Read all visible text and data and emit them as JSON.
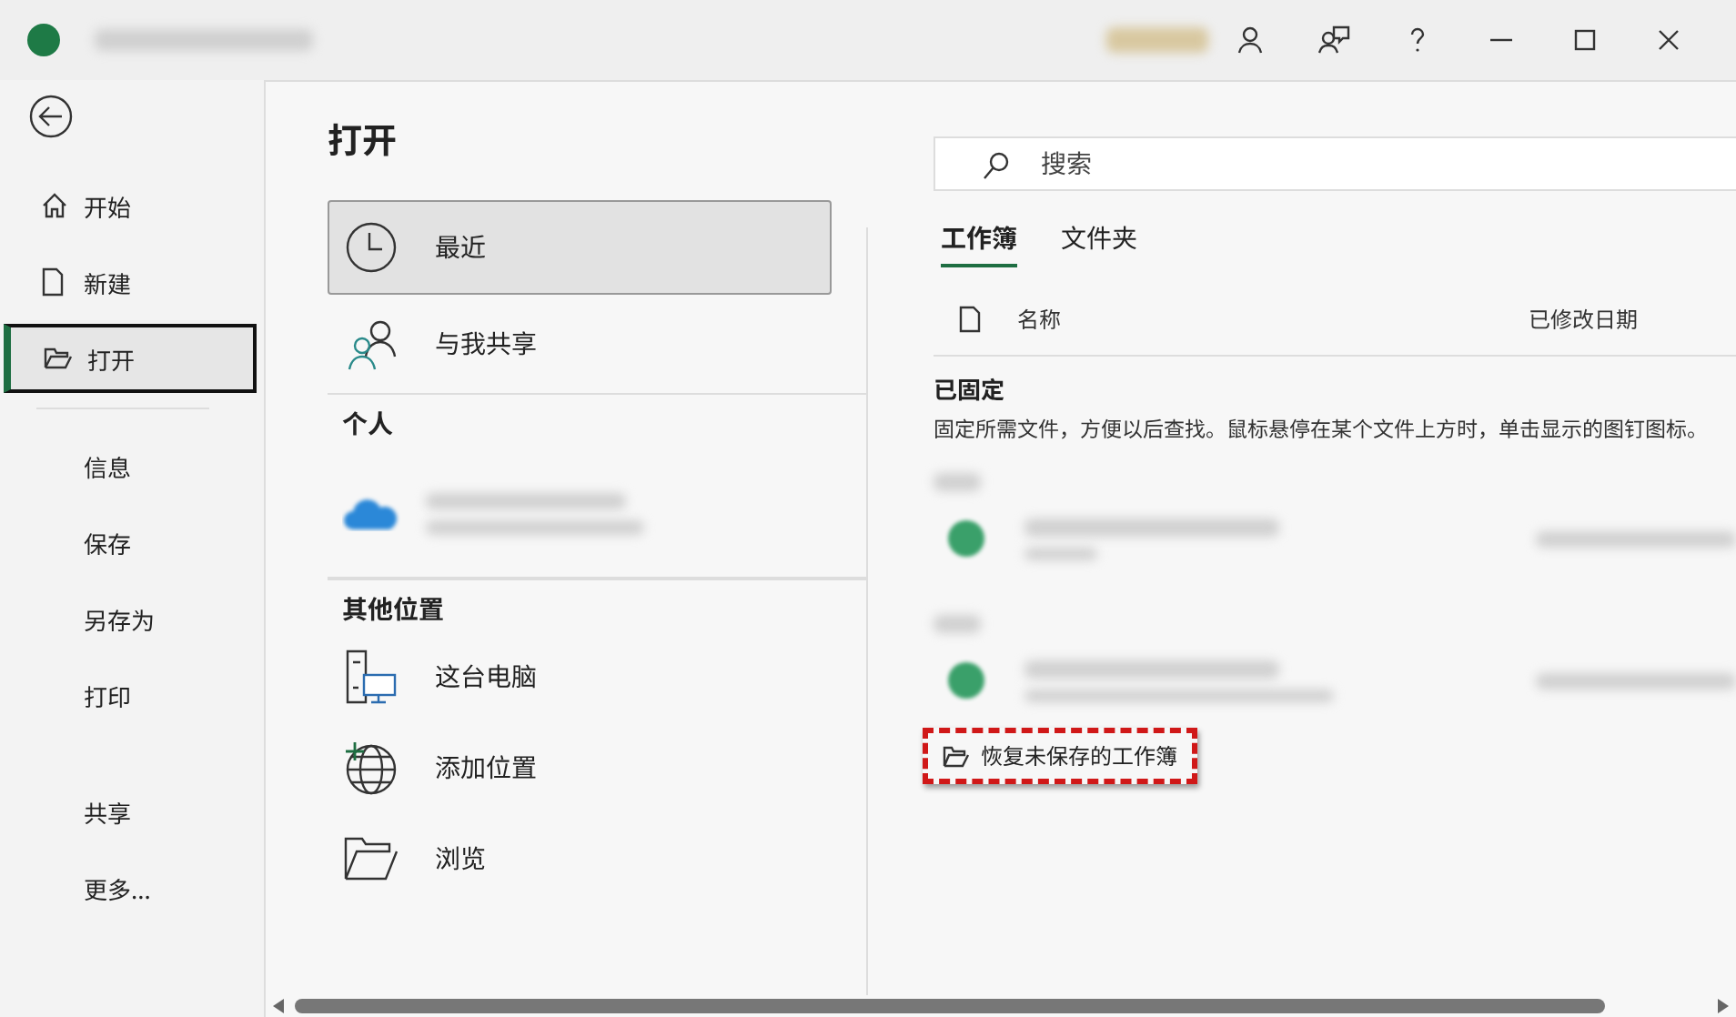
{
  "nav": [
    {
      "label": "开始",
      "selected": false
    },
    {
      "label": "新建",
      "selected": false
    },
    {
      "label": "打开",
      "selected": true
    },
    {
      "label": "信息",
      "selected": false
    },
    {
      "label": "保存",
      "selected": false
    },
    {
      "label": "另存为",
      "selected": false
    },
    {
      "label": "打印",
      "selected": false
    },
    {
      "label": "共享",
      "selected": false
    },
    {
      "label": "更多...",
      "selected": false
    }
  ],
  "page_title": "打开",
  "locations": [
    {
      "kind": "item",
      "label": "最近",
      "selected": true
    },
    {
      "kind": "item",
      "label": "与我共享",
      "selected": false
    },
    {
      "kind": "header",
      "label": "个人"
    },
    {
      "kind": "cloud"
    },
    {
      "kind": "header",
      "label": "其他位置"
    },
    {
      "kind": "item",
      "label": "这台电脑",
      "selected": false
    },
    {
      "kind": "item",
      "label": "添加位置",
      "selected": false
    },
    {
      "kind": "item",
      "label": "浏览",
      "selected": false
    }
  ],
  "search": {
    "placeholder": "搜索"
  },
  "tabs": [
    {
      "label": "工作簿",
      "selected": true
    },
    {
      "label": "文件夹",
      "selected": false
    }
  ],
  "columns": [
    "名称",
    "已修改日期"
  ],
  "pinned": {
    "title": "已固定",
    "hint": "固定所需文件，方便以后查找。鼠标悬停在某个文件上方时，单击显示的图钉图标。"
  },
  "recover": "恢复未保存的工作簿"
}
